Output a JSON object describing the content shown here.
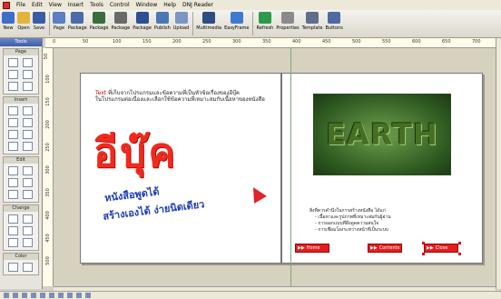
{
  "menubar": {
    "items": [
      "File",
      "Edit",
      "View",
      "Insert",
      "Tools",
      "Control",
      "Window",
      "Help",
      "DNJ Reader"
    ]
  },
  "toolbar": {
    "buttons": [
      {
        "label": "New",
        "icon": "new-document-icon",
        "color": "#3b6fc9"
      },
      {
        "label": "Open",
        "icon": "open-folder-icon",
        "color": "#e3b43c"
      },
      {
        "label": "Save",
        "icon": "save-disk-icon",
        "color": "#3a5ca6"
      },
      {
        "label": "Page",
        "icon": "page-icon",
        "color": "#5a7fc2"
      },
      {
        "label": "Package",
        "icon": "package-icon",
        "color": "#4a6da8"
      },
      {
        "label": "Package",
        "icon": "package-icon",
        "color": "#3c6b3c"
      },
      {
        "label": "Package",
        "icon": "package-icon",
        "color": "#6a6a6a"
      },
      {
        "label": "Package",
        "icon": "package-icon",
        "color": "#2e4f92"
      },
      {
        "label": "Publish",
        "icon": "publish-icon",
        "color": "#4b78b5"
      },
      {
        "label": "Upload",
        "icon": "upload-icon",
        "color": "#7b96c3"
      },
      {
        "label": "Multimedia",
        "icon": "multimedia-icon",
        "color": "#2d4d80"
      },
      {
        "label": "EasyFrame",
        "icon": "easyframe-icon",
        "color": "#3c7bd0"
      },
      {
        "label": "Refresh",
        "icon": "refresh-icon",
        "color": "#2c9a4a"
      },
      {
        "label": "Properties",
        "icon": "properties-icon",
        "color": "#8a8a8a"
      },
      {
        "label": "Template",
        "icon": "template-icon",
        "color": "#5e6e8c"
      },
      {
        "label": "Buttons",
        "icon": "buttons-icon",
        "color": "#4d6aa3"
      }
    ]
  },
  "tools_panel": {
    "title": "Tools",
    "groups": [
      {
        "title": "Page",
        "count": 6
      },
      {
        "title": "Insert",
        "count": 8
      },
      {
        "title": "Edit",
        "count": 6
      },
      {
        "title": "Change",
        "count": 6
      },
      {
        "title": "Color",
        "count": 2
      }
    ]
  },
  "ruler": {
    "top": [
      "0",
      "50",
      "100",
      "150",
      "200",
      "250",
      "300",
      "350",
      "400",
      "450",
      "500",
      "550",
      "600",
      "650",
      "700"
    ],
    "left": [
      "50",
      "100",
      "150",
      "200",
      "250",
      "300",
      "350",
      "400",
      "450",
      "500"
    ]
  },
  "left_page": {
    "heading_prefix": "Text",
    "heading_rest": " ที่เก็บจากโปรแกรมและข้อความที่เป็นหัวข้อเรื่องของอีบุ๊ค",
    "heading_line2": "ในโปรแกรมต่อเนื่องและเลือกใช้ข้อความที่เหมาะสมกับเนื้อหาของหนังสือ",
    "title": "อีบุ๊ค",
    "subtitle_1": "หนังสือพูดได้",
    "subtitle_2": "สร้างเองได้ ง่ายนิดเดียว"
  },
  "right_page": {
    "image_text": "EARTH",
    "bullets_intro": "สิ่งที่ควรคำนึงในการสร้างหนังสือ ได้แก่",
    "bullets": [
      "- เนื้อหาและรูปภาพที่เหมาะสมกับผู้อ่าน",
      "- การออกแบบที่ดึงดูดความสนใจ",
      "- การเชื่อมโยงระหว่างหน้าที่เป็นระบบ"
    ],
    "buttons": [
      {
        "label": "Home"
      },
      {
        "label": "Contents"
      },
      {
        "label": "Close"
      }
    ]
  },
  "colors": {
    "title_red": "#ee2b1e",
    "subtitle_blue": "#1a3cb4",
    "nav_button": "#e02020"
  }
}
